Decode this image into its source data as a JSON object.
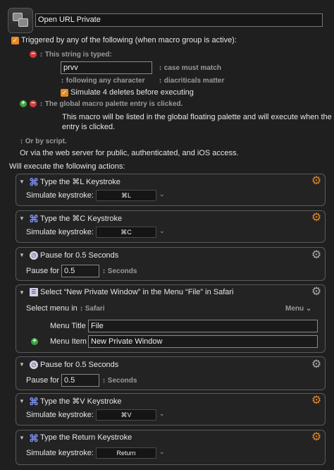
{
  "macro": {
    "name": "Open URL Private"
  },
  "trigger": {
    "triggered_label": "Triggered by any of the following (when macro group is active):",
    "typed_label": "↕ This string is typed:",
    "typed_value": "prvv",
    "case_label": "↕ case must match",
    "following_label": "↕ following any character",
    "diacriticals_label": "↕ diacriticals matter",
    "simulate_label": "Simulate 4 deletes before executing",
    "palette_label": "↕ The global macro palette entry is clicked.",
    "palette_desc_1": "This macro will be listed in the global floating palette and will execute when the",
    "palette_desc_2": "entry is clicked.",
    "script_label": "↕ Or by script.",
    "web_label": "Or via the web server for public, authenticated, and iOS access.",
    "will_execute": "Will execute the following actions:"
  },
  "actions": [
    {
      "title": "Type the ⌘L Keystroke",
      "row_label": "Simulate keystroke:",
      "value": "⌘L",
      "gear_color": "#e08a2a"
    },
    {
      "title": "Type the ⌘C Keystroke",
      "row_label": "Simulate keystroke:",
      "value": "⌘C",
      "gear_color": "#e08a2a"
    },
    {
      "title": "Pause for 0.5 Seconds",
      "row_label": "Pause for",
      "value": "0.5",
      "unit": "↕ Seconds"
    },
    {
      "title": "Select “New Private Window” in the Menu “File” in Safari",
      "select_label": "Select menu in",
      "app": "↕ Safari",
      "menu_dd": "Menu ⌄",
      "menu_title_label": "Menu Title",
      "menu_title_value": "File",
      "menu_item_label": "Menu Item",
      "menu_item_value": "New Private Window"
    },
    {
      "title": "Pause for 0.5 Seconds",
      "row_label": "Pause for",
      "value": "0.5",
      "unit": "↕ Seconds"
    },
    {
      "title": "Type the ⌘V Keystroke",
      "row_label": "Simulate keystroke:",
      "value": "⌘V"
    },
    {
      "title": "Type the Return Keystroke",
      "row_label": "Simulate keystroke:",
      "value": "Return"
    }
  ],
  "icons": {
    "checkmark": "✓",
    "disclosure": "▼",
    "cmd": "⌘",
    "gear": "⚙",
    "chevron": "⌄",
    "minus": "−",
    "plus": "+",
    "clock": "◷",
    "menu": "☰"
  },
  "colors": {
    "accent": "#e58a22",
    "minus": "#d83b3b",
    "plus": "#35a63a",
    "cmd": "#7a8ce8"
  }
}
